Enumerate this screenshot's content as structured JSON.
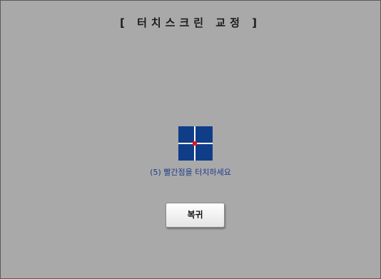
{
  "screen": {
    "title": "[ 터치스크린 교정 ]",
    "background_color": "#a9a9a9"
  },
  "calibration": {
    "target_icon": "crosshair-target-icon",
    "target_color": "#0f3d87",
    "marker_color": "#e6121a",
    "instruction": "(5) 빨간점을 터치하세요"
  },
  "buttons": {
    "return_label": "복귀"
  }
}
